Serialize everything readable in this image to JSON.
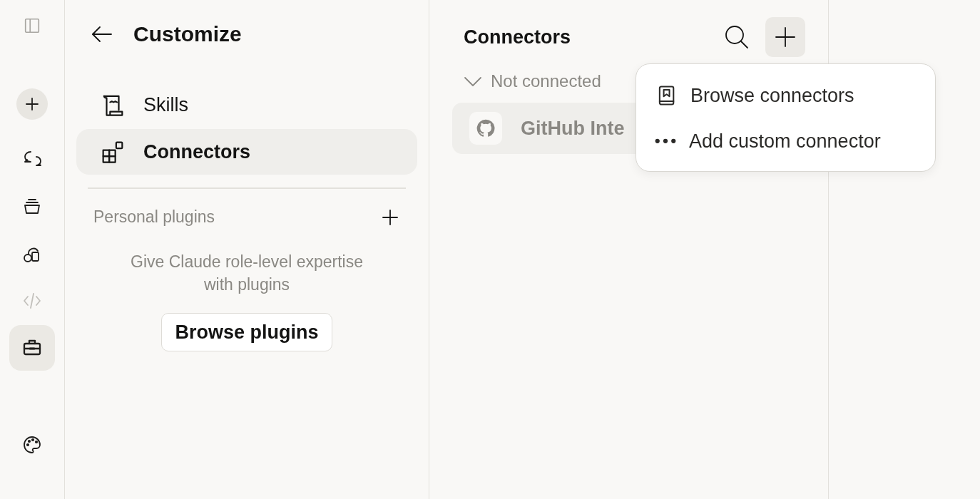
{
  "rail": {
    "items": [
      {
        "kind": "sidebar-toggle",
        "selected": false,
        "disabled": false
      },
      {
        "kind": "new",
        "selected": false,
        "disabled": false
      },
      {
        "kind": "chats",
        "selected": false,
        "disabled": false
      },
      {
        "kind": "projects",
        "selected": false,
        "disabled": false
      },
      {
        "kind": "artifacts",
        "selected": false,
        "disabled": false
      },
      {
        "kind": "code",
        "selected": false,
        "disabled": true
      },
      {
        "kind": "customize",
        "selected": true,
        "disabled": false
      }
    ],
    "footer": {
      "kind": "palette"
    }
  },
  "customize": {
    "title": "Customize",
    "nav": [
      {
        "kind": "skills",
        "label": "Skills",
        "selected": false
      },
      {
        "kind": "connectors",
        "label": "Connectors",
        "selected": true
      }
    ],
    "section": {
      "title": "Personal plugins"
    },
    "empty_text": "Give Claude role-level expertise with plugins",
    "button": "Browse plugins"
  },
  "connectors": {
    "title": "Connectors",
    "group": {
      "label": "Not connected",
      "expanded": true
    },
    "items": [
      {
        "name": "GitHub Inte"
      }
    ],
    "menu": [
      {
        "kind": "browse",
        "label": "Browse connectors"
      },
      {
        "kind": "custom",
        "label": "Add custom connector"
      }
    ]
  }
}
